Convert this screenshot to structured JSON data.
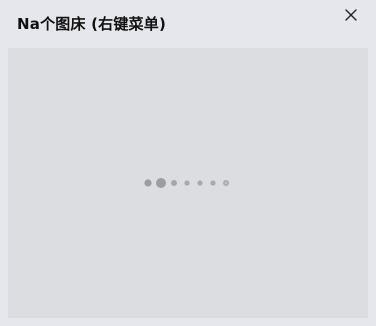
{
  "window": {
    "title": "Na个图床 (右键菜单)",
    "close_icon": "close-icon"
  },
  "content": {
    "state": "loading",
    "loader_icon": "loading-dots-icon",
    "background_color": "#dcdde1"
  },
  "colors": {
    "window_bg": "#e6e7ec",
    "dot_dark": "#9a9da3",
    "dot_light": "#a9acb1"
  }
}
